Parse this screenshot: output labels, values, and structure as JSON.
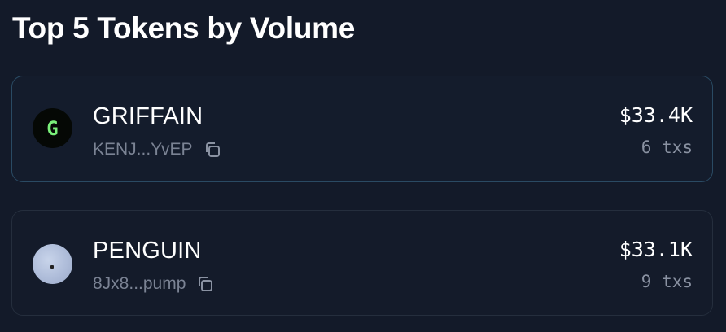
{
  "header": {
    "title": "Top 5 Tokens by Volume"
  },
  "tokens": [
    {
      "name": "GRIFFAIN",
      "address": "KENJ...YvEP",
      "volume": "$33.4K",
      "txs": "6 txs",
      "logo_letter": "G",
      "logo_icon": "griffain-logo-icon",
      "copy_icon": "copy-icon"
    },
    {
      "name": "PENGUIN",
      "address": "8Jx8...pump",
      "volume": "$33.1K",
      "txs": "9 txs",
      "logo_icon": "penguin-logo-icon",
      "copy_icon": "copy-icon"
    }
  ],
  "colors": {
    "background": "#131a29",
    "card_highlight_border": "#2a4a63",
    "card_border": "#252e3d",
    "muted_text": "#7b8394",
    "logo_letter": "#7af07a"
  }
}
